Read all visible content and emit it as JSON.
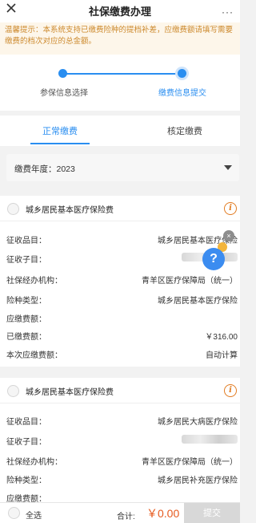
{
  "topbar": {
    "title": "社保缴费办理",
    "more": "···"
  },
  "notice": {
    "text": "温馨提示：本系统支持已缴费险种的提档补差，应缴费额请填写需要缴费的档次对应的总金额。"
  },
  "steps": {
    "step1": "参保信息选择",
    "step2": "缴费信息提交"
  },
  "tabs": {
    "normal": "正常缴费",
    "verified": "核定缴费"
  },
  "year_select": {
    "label": "缴费年度：2023"
  },
  "cards": [
    {
      "name": "城乡居民基本医疗保险费",
      "rows": [
        {
          "k": "征收品目：",
          "v": "城乡居民基本医疗保险"
        },
        {
          "k": "征收子目：",
          "v": ""
        },
        {
          "k": "社保经办机构：",
          "v": "青羊区医疗保障局（统一）"
        },
        {
          "k": "险种类型：",
          "v": "城乡居民基本医疗保险"
        },
        {
          "k": "应缴费额：",
          "v": ""
        },
        {
          "k": "已缴费额：",
          "v": "￥316.00"
        },
        {
          "k": "本次应缴费额：",
          "v": "自动计算"
        }
      ]
    },
    {
      "name": "城乡居民基本医疗保险费",
      "rows": [
        {
          "k": "征收品目：",
          "v": "城乡居民大病医疗保险"
        },
        {
          "k": "征收子目：",
          "v": ""
        },
        {
          "k": "社保经办机构：",
          "v": "青羊区医疗保障局（统一）"
        },
        {
          "k": "险种类型：",
          "v": "城乡居民补充医疗保险"
        },
        {
          "k": "应缴费额：",
          "v": ""
        }
      ]
    }
  ],
  "helper": {
    "glyph": "?",
    "close": "×"
  },
  "bottom": {
    "select_all": "全选",
    "total_label": "合计:",
    "total_value": "￥0.00",
    "submit": "提交"
  },
  "colors": {
    "accent": "#2a8ef0",
    "warning": "#cd8a2e",
    "price": "#e65a1e"
  }
}
